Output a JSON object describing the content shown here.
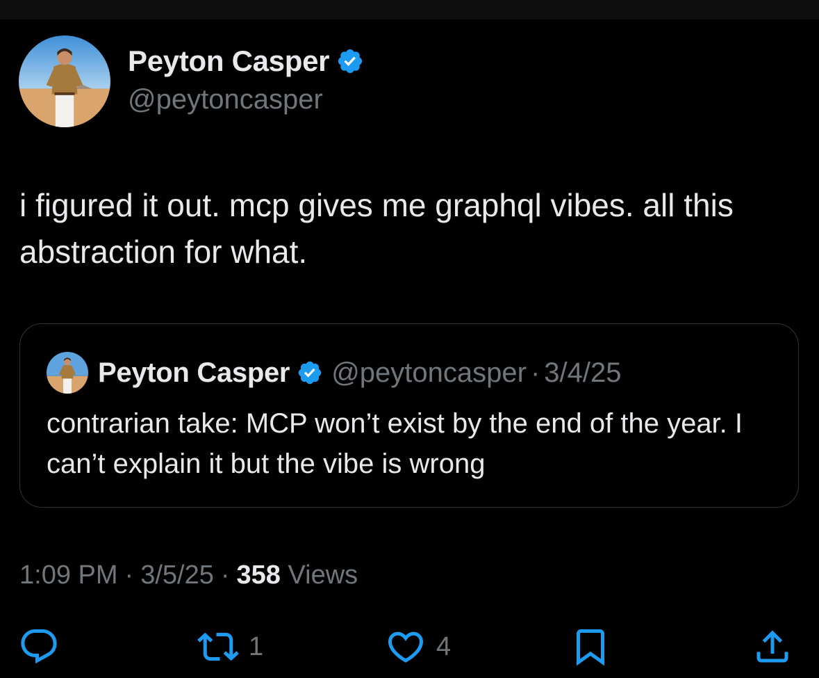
{
  "tweet": {
    "author": {
      "name": "Peyton Casper",
      "handle": "@peytoncasper",
      "verified": true,
      "avatar_icon": "profile-photo-man-in-desert"
    },
    "text": "i figured it out. mcp gives me graphql vibes. all this abstraction for what.",
    "quoted": {
      "name": "Peyton Casper",
      "handle": "@peytoncasper",
      "separator": "·",
      "date": "3/4/25",
      "text": "contrarian take: MCP won’t exist by the end of the year. I can’t explain it but the vibe is wrong"
    },
    "meta": {
      "time": "1:09 PM",
      "separator": "·",
      "date": "3/5/25",
      "views_count": "358",
      "views_label": "Views"
    },
    "actions": {
      "reply_icon": "reply-icon",
      "retweet_icon": "retweet-icon",
      "retweet_count": "1",
      "like_icon": "heart-icon",
      "like_count": "4",
      "bookmark_icon": "bookmark-icon",
      "share_icon": "share-icon"
    }
  },
  "colors": {
    "background": "#000000",
    "text_primary": "#e7e9ea",
    "text_secondary": "#71767b",
    "verified_blue": "#1d9bf0",
    "border": "#2f3336"
  }
}
